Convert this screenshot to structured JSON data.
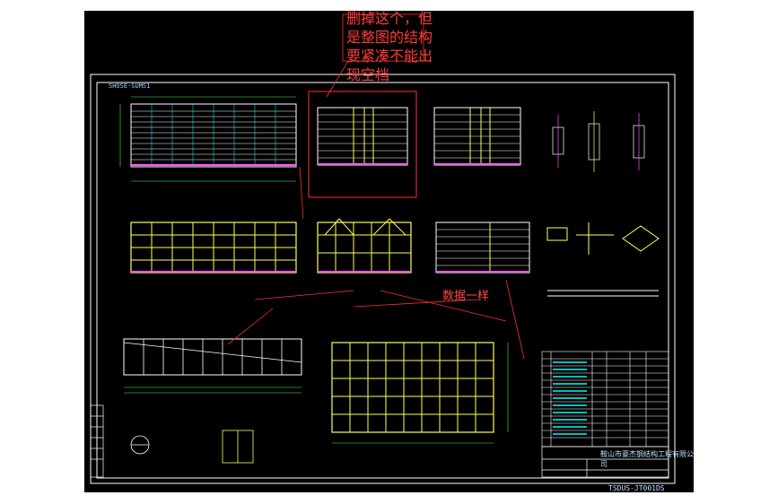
{
  "annotations": {
    "main_note": [
      "删掉这个，但",
      "是整图的结构",
      "要紧凑不能出",
      "现空档"
    ],
    "data_note": "数据一样"
  },
  "title_block": {
    "company": "鞍山市豪杰钢结构工程有限公司",
    "drawing_no": "TSDUS-JT001DS"
  },
  "sheet_code": "SHOSE·SUMS1",
  "colors": {
    "background": "#000000",
    "frame": "#ffffff",
    "steel": "#ffff55",
    "panel": "#ffffff",
    "dimension": "#44ff44",
    "markup": "#ff3030",
    "node": "#ff55ff",
    "table_text": "#00ffff"
  }
}
